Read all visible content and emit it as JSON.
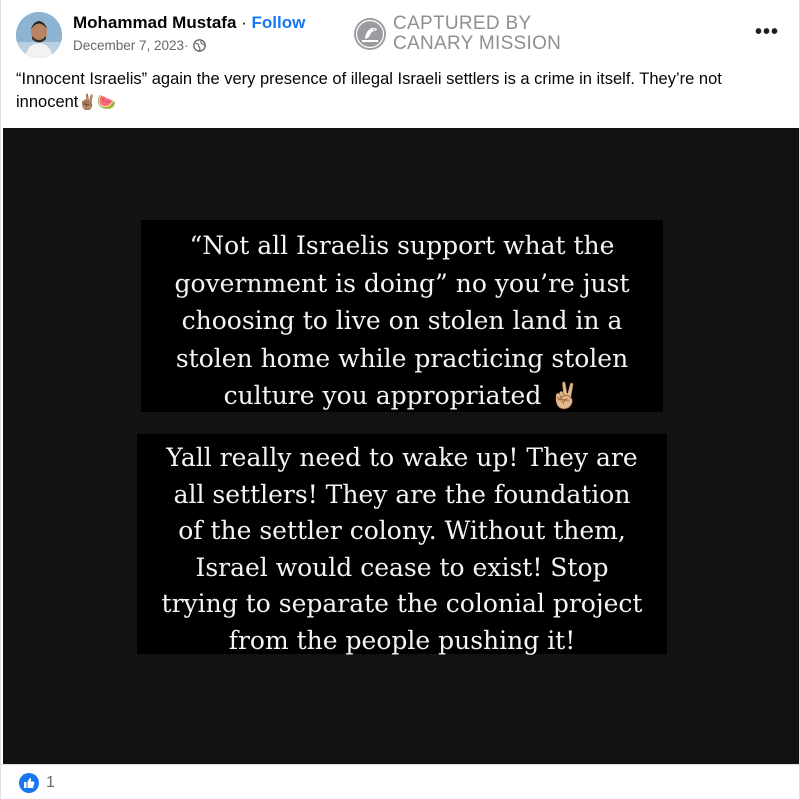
{
  "post": {
    "author": {
      "name": "Mohammad Mustafa",
      "separator": " · ",
      "follow_label": "Follow"
    },
    "date": "December 7, 2023",
    "meta_separator": " · ",
    "privacy_icon": "globe-icon",
    "more_icon": "more-options-icon",
    "more_label": "•••",
    "caption": {
      "text": "“Innocent Israelis” again the very presence of illegal Israeli settlers is a crime in itself. They’re not innocent",
      "emojis": "✌🏽🍉"
    },
    "watermark": {
      "line1": "CAPTURED BY",
      "line2": "CANARY MISSION"
    },
    "image_text": {
      "box1": [
        "“Not all Israelis support what the",
        "government is doing” no you’re just",
        "choosing to live on stolen land in a",
        "stolen home while practicing stolen",
        "culture you appropriated ✌🏼"
      ],
      "box2": [
        "Yall really need to wake up! They are",
        "all settlers! They are the foundation",
        "of the settler colony. Without them,",
        "Israel would cease to exist! Stop",
        "trying to separate the colonial project",
        "from the people pushing it!"
      ]
    },
    "reactions": {
      "icon": "like-icon",
      "count": "1"
    },
    "colors": {
      "link": "#1877f2",
      "image_background": "#121212",
      "text_box": "#000000",
      "watermark": "#8d8f92"
    }
  }
}
